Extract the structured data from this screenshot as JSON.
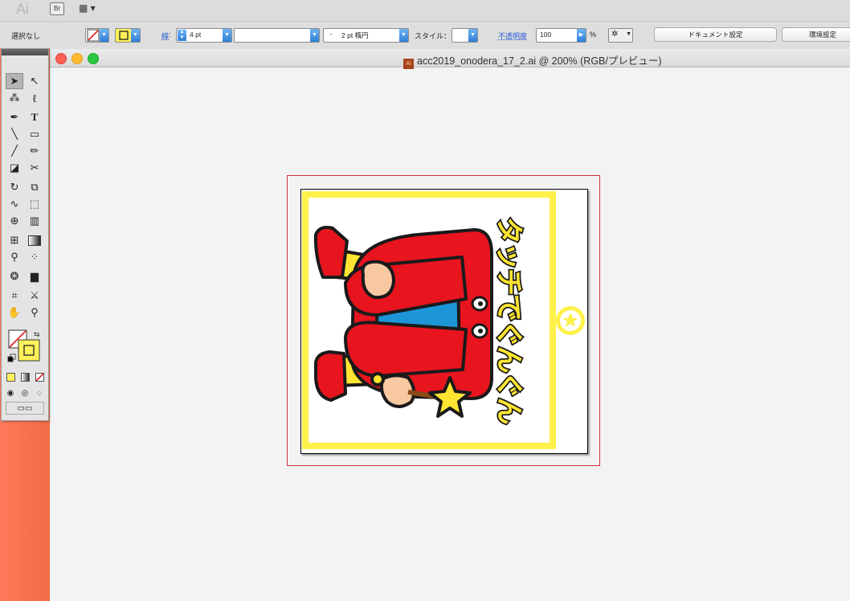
{
  "app": {
    "logo": "Ai",
    "bridge_label": "Br",
    "workspace_icon": "workspace-switcher-icon"
  },
  "control_bar": {
    "selection_status": "選択なし",
    "stroke_label": "線",
    "stroke_weight": "4 pt",
    "variable_width": "",
    "brush_definition": "2 pt 楕円",
    "style_label": "スタイル：",
    "opacity_label": "不透明度",
    "opacity_value": "100",
    "opacity_unit": "%",
    "doc_settings": "ドキュメント設定",
    "preferences": "環境設定"
  },
  "document": {
    "title": "acc2019_onodera_17_2.ai @ 200% (RGB/プレビュー)",
    "file_icon_label": "Ai"
  },
  "artwork": {
    "vertical_text": "タッチでぐんぐん",
    "colors": {
      "frame_yellow": "#fff04a",
      "text_yellow": "#ffe531",
      "suit_red": "#e8141e",
      "cape_blue": "#1d96d8",
      "skin": "#f8c8a0",
      "outline": "#1a1a1a",
      "bleed_red": "#d0303a"
    }
  }
}
